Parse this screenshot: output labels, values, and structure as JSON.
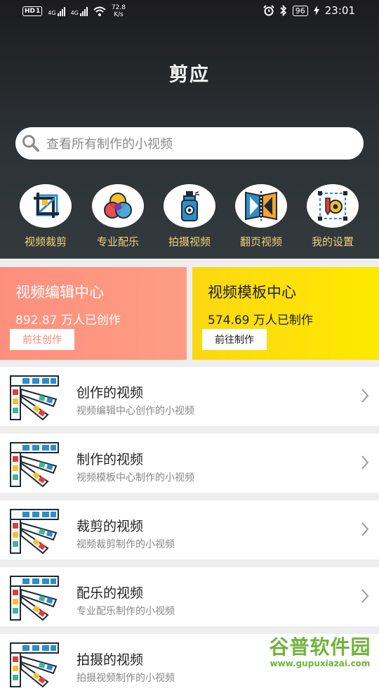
{
  "status_bar": {
    "hd": "HD",
    "sim1": "1",
    "net1": "4G",
    "net2": "4G",
    "speed_value": "72.8",
    "speed_unit": "K/s",
    "battery": "96",
    "time": "23:01"
  },
  "app_title": "剪应",
  "search": {
    "placeholder": "查看所有制作的小视频"
  },
  "quick_actions": [
    {
      "label": "视频裁剪",
      "icon": "crop-icon"
    },
    {
      "label": "专业配乐",
      "icon": "color-circles-icon"
    },
    {
      "label": "拍摄视频",
      "icon": "spray-bottle-icon"
    },
    {
      "label": "翻页视频",
      "icon": "page-flip-icon"
    },
    {
      "label": "我的设置",
      "icon": "settings-gear-icon"
    }
  ],
  "cards": [
    {
      "title": "视频编辑中心",
      "count": "892.87 万人已创作",
      "button": "前往创作",
      "color": "#fe8f7e"
    },
    {
      "title": "视频模板中心",
      "count": "574.69 万人已制作",
      "button": "前往制作",
      "color": "#fbd812"
    }
  ],
  "video_list": [
    {
      "title": "创作的视频",
      "subtitle": "视频编辑中心创作的小视频"
    },
    {
      "title": "制作的视频",
      "subtitle": "视频模板中心制作的小视频"
    },
    {
      "title": "裁剪的视频",
      "subtitle": "视频裁剪制作的小视频"
    },
    {
      "title": "配乐的视频",
      "subtitle": "专业配乐制作的小视频"
    },
    {
      "title": "拍摄的视频",
      "subtitle": "拍摄视频制作的小视频"
    }
  ],
  "watermark": {
    "name": "谷普软件园",
    "url": "www.gupuxiazai.com"
  }
}
